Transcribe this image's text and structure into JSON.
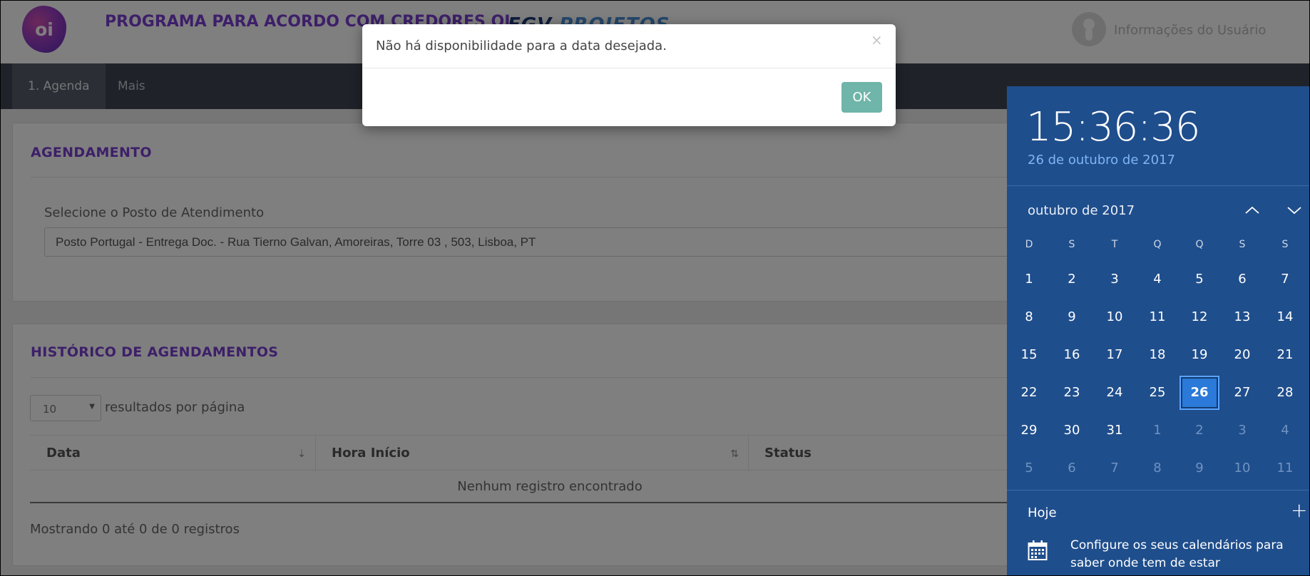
{
  "header": {
    "logo_text": "oi",
    "title": "PROGRAMA PARA ACORDO COM CREDORES OI",
    "partner_logo": {
      "part1": "FGV",
      "part2": "PROJETOS"
    },
    "user_label": "Informações do Usuário"
  },
  "nav": {
    "items": [
      {
        "label": "1. Agenda",
        "active": true
      },
      {
        "label": "Mais",
        "active": false
      }
    ]
  },
  "agendamento": {
    "title": "AGENDAMENTO",
    "field_label": "Selecione o Posto de Atendimento",
    "selected_posto": "Posto Portugal - Entrega Doc. - Rua Tierno Galvan, Amoreiras, Torre 03 , 503, Lisboa, PT"
  },
  "historico": {
    "title": "HISTÓRICO DE AGENDAMENTOS",
    "page_size": "10",
    "page_size_label": "resultados por página",
    "columns": [
      "Data",
      "Hora Início",
      "Status"
    ],
    "empty_message": "Nenhum registro encontrado",
    "info": "Mostrando 0 até 0 de 0 registros"
  },
  "modal": {
    "message": "Não há disponibilidade para a data desejada.",
    "close_glyph": "×",
    "ok_label": "OK"
  },
  "calendar_flyout": {
    "time": "15:36:36",
    "long_date": "26 de outubro de 2017",
    "month_label": "outubro de 2017",
    "weekdays": [
      "D",
      "S",
      "T",
      "Q",
      "Q",
      "S",
      "S"
    ],
    "weeks": [
      [
        "1",
        "2",
        "3",
        "4",
        "5",
        "6",
        "7"
      ],
      [
        "8",
        "9",
        "10",
        "11",
        "12",
        "13",
        "14"
      ],
      [
        "15",
        "16",
        "17",
        "18",
        "19",
        "20",
        "21"
      ],
      [
        "22",
        "23",
        "24",
        "25",
        "26",
        "27",
        "28"
      ],
      [
        "29",
        "30",
        "31",
        "1",
        "2",
        "3",
        "4"
      ],
      [
        "5",
        "6",
        "7",
        "8",
        "9",
        "10",
        "11"
      ]
    ],
    "today": "26",
    "agenda_label": "Hoje",
    "agenda_message": "Configure os seus calendários para saber onde tem de estar",
    "colors": {
      "background": "#1f4e8c",
      "accent": "#2b79d8",
      "date_text": "#7fb4f5"
    }
  },
  "colors": {
    "brand_purple": "#7b3fd3",
    "nav_bg": "#3e4652",
    "ok_button": "#6fb5a9"
  }
}
